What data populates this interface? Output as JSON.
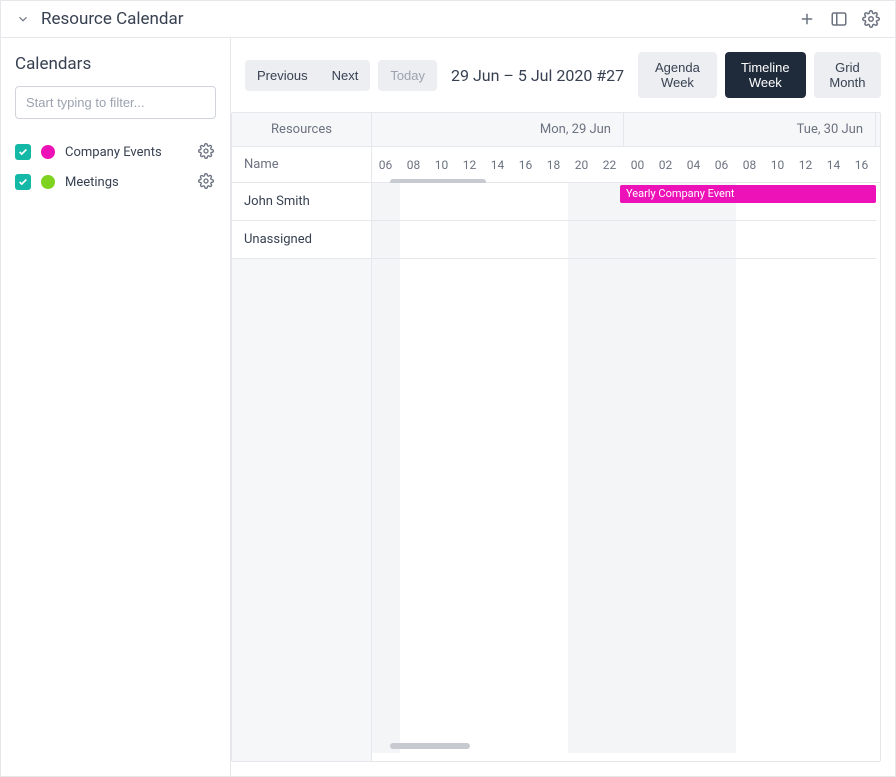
{
  "header": {
    "title": "Resource Calendar"
  },
  "sidebar": {
    "title": "Calendars",
    "filter_placeholder": "Start typing to filter...",
    "calendars": [
      {
        "label": "Company Events",
        "color": "#ec12b8"
      },
      {
        "label": "Meetings",
        "color": "#7ed321"
      }
    ]
  },
  "toolbar": {
    "prev": "Previous",
    "next": "Next",
    "today": "Today",
    "date_range": "29 Jun – 5 Jul 2020 #27",
    "views": {
      "agenda": "Agenda Week",
      "timeline": "Timeline Week",
      "month": "Grid Month"
    },
    "active_view": "timeline"
  },
  "grid": {
    "resources_header": "Resources",
    "name_header": "Name",
    "days": [
      "Mon, 29 Jun",
      "Tue, 30 Jun"
    ],
    "hours": [
      "06",
      "08",
      "10",
      "12",
      "14",
      "16",
      "18",
      "20",
      "22",
      "00",
      "02",
      "04",
      "06",
      "08",
      "10",
      "12",
      "14",
      "16"
    ],
    "resources": [
      "John Smith",
      "Unassigned"
    ],
    "events": [
      {
        "title": "Yearly Company Event",
        "resource_index": 0,
        "color": "#ec12b8"
      }
    ]
  }
}
